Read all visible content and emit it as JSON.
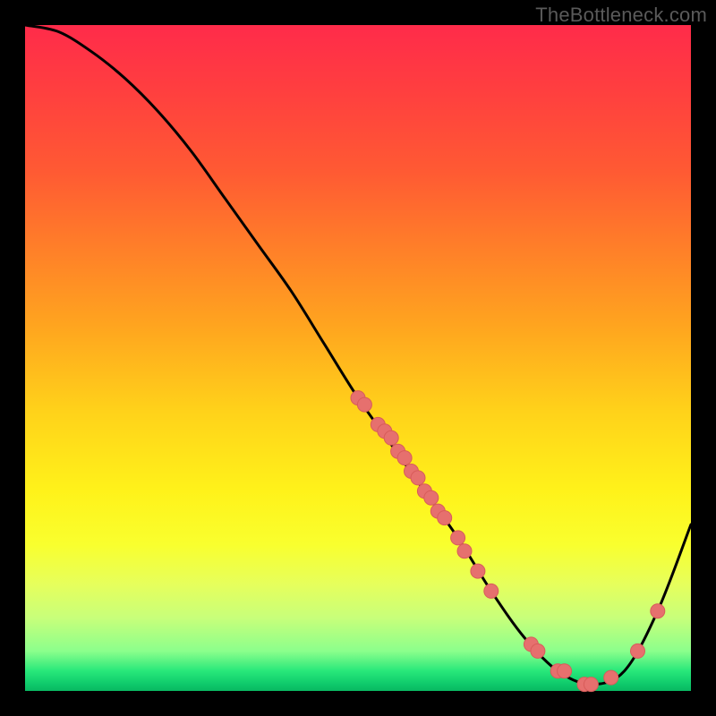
{
  "watermark": "TheBottleneck.com",
  "chart_data": {
    "type": "line",
    "title": "",
    "xlabel": "",
    "ylabel": "",
    "xlim": [
      0,
      100
    ],
    "ylim": [
      0,
      100
    ],
    "curve": {
      "x": [
        0,
        5,
        10,
        15,
        20,
        25,
        30,
        35,
        40,
        45,
        50,
        55,
        60,
        65,
        70,
        75,
        80,
        85,
        90,
        95,
        100
      ],
      "y": [
        100,
        99,
        96,
        92,
        87,
        81,
        74,
        67,
        60,
        52,
        44,
        37,
        30,
        23,
        15,
        8,
        3,
        1,
        3,
        12,
        25
      ]
    },
    "highlight_dots": [
      {
        "x": 50,
        "y": 44
      },
      {
        "x": 51,
        "y": 43
      },
      {
        "x": 53,
        "y": 40
      },
      {
        "x": 54,
        "y": 39
      },
      {
        "x": 55,
        "y": 38
      },
      {
        "x": 56,
        "y": 36
      },
      {
        "x": 57,
        "y": 35
      },
      {
        "x": 58,
        "y": 33
      },
      {
        "x": 59,
        "y": 32
      },
      {
        "x": 60,
        "y": 30
      },
      {
        "x": 61,
        "y": 29
      },
      {
        "x": 62,
        "y": 27
      },
      {
        "x": 63,
        "y": 26
      },
      {
        "x": 65,
        "y": 23
      },
      {
        "x": 66,
        "y": 21
      },
      {
        "x": 68,
        "y": 18
      },
      {
        "x": 70,
        "y": 15
      },
      {
        "x": 76,
        "y": 7
      },
      {
        "x": 77,
        "y": 6
      },
      {
        "x": 80,
        "y": 3
      },
      {
        "x": 81,
        "y": 3
      },
      {
        "x": 84,
        "y": 1
      },
      {
        "x": 85,
        "y": 1
      },
      {
        "x": 88,
        "y": 2
      },
      {
        "x": 92,
        "y": 6
      },
      {
        "x": 95,
        "y": 12
      }
    ],
    "colors": {
      "curve_stroke": "#000000",
      "dot_fill": "#e6706e",
      "dot_stroke": "#d85c5a"
    }
  }
}
